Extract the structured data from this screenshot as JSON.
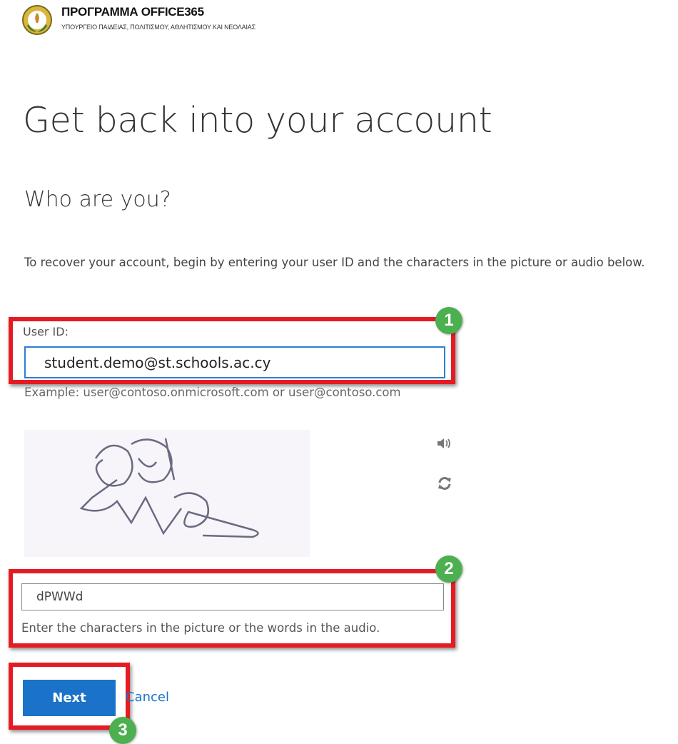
{
  "header": {
    "brand_title": "ΠΡΟΓΡΑΜΜΑ OFFICE365",
    "brand_subtitle": "ΥΠΟΥΡΓΕΙΟ ΠΑΙΔΕΙΑΣ, ΠΟΛΙΤΙΣΜΟΥ, ΑΘΛΗΤΙΣΜΟΥ ΚΑΙ ΝΕΟΛΑΙΑΣ"
  },
  "page": {
    "title": "Get back into your account",
    "subtitle": "Who are you?",
    "intro": "To recover your account, begin by entering your user ID and the characters in the picture or audio below."
  },
  "form": {
    "user_id_label": "User ID:",
    "user_id_value": "student.demo@st.schools.ac.cy",
    "user_id_example": "Example: user@contoso.onmicrosoft.com or user@contoso.com",
    "captcha_value": "dPWWd",
    "captcha_hint": "Enter the characters in the picture or the words in the audio.",
    "speaker_icon": "speaker-icon",
    "refresh_icon": "refresh-icon"
  },
  "actions": {
    "next_label": "Next",
    "cancel_label": "Cancel"
  },
  "annotations": {
    "step_1": "1",
    "step_2": "2",
    "step_3": "3"
  },
  "colors": {
    "accent_blue": "#1a73c8",
    "highlight_red": "#e41b23",
    "badge_green": "#4caf50"
  }
}
